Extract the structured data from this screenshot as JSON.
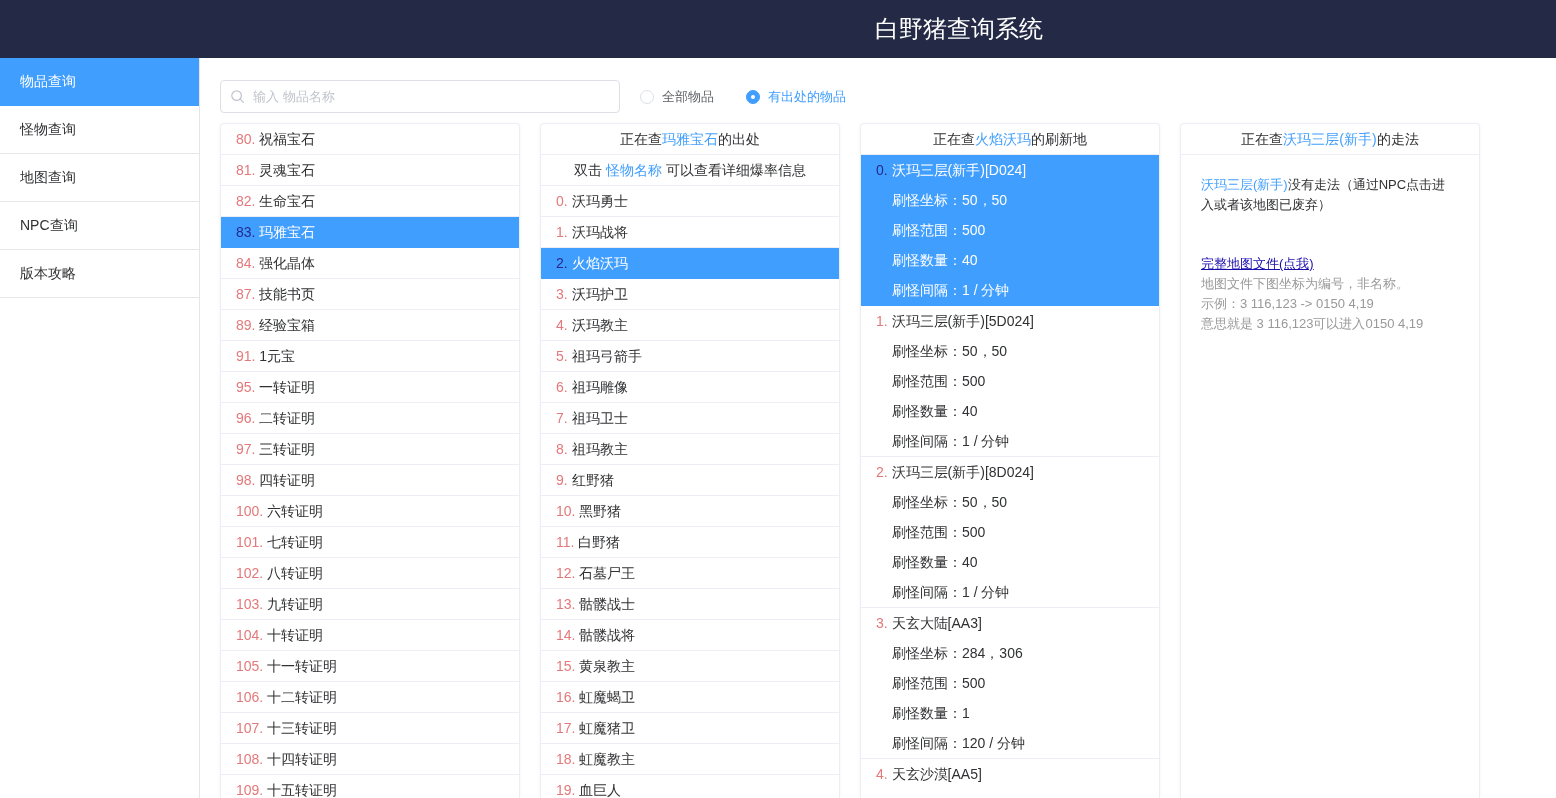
{
  "header": {
    "title": "白野猪查询系统"
  },
  "sidebar": {
    "items": [
      {
        "label": "物品查询",
        "selected": true
      },
      {
        "label": "怪物查询",
        "selected": false
      },
      {
        "label": "地图查询",
        "selected": false
      },
      {
        "label": "NPC查询",
        "selected": false
      },
      {
        "label": "版本攻略",
        "selected": false
      }
    ]
  },
  "search": {
    "placeholder": "输入 物品名称"
  },
  "filter": {
    "options": [
      {
        "label": "全部物品",
        "selected": false
      },
      {
        "label": "有出处的物品",
        "selected": true
      }
    ]
  },
  "items_panel": {
    "rows": [
      {
        "number": "80.",
        "name": "祝福宝石",
        "selected": false
      },
      {
        "number": "81.",
        "name": "灵魂宝石",
        "selected": false
      },
      {
        "number": "82.",
        "name": "生命宝石",
        "selected": false
      },
      {
        "number": "83.",
        "name": "玛雅宝石",
        "selected": true
      },
      {
        "number": "84.",
        "name": "强化晶体",
        "selected": false
      },
      {
        "number": "87.",
        "name": "技能书页",
        "selected": false
      },
      {
        "number": "89.",
        "name": "经验宝箱",
        "selected": false
      },
      {
        "number": "91.",
        "name": "1元宝",
        "selected": false
      },
      {
        "number": "95.",
        "name": "一转证明",
        "selected": false
      },
      {
        "number": "96.",
        "name": "二转证明",
        "selected": false
      },
      {
        "number": "97.",
        "name": "三转证明",
        "selected": false
      },
      {
        "number": "98.",
        "name": "四转证明",
        "selected": false
      },
      {
        "number": "100.",
        "name": "六转证明",
        "selected": false
      },
      {
        "number": "101.",
        "name": "七转证明",
        "selected": false
      },
      {
        "number": "102.",
        "name": "八转证明",
        "selected": false
      },
      {
        "number": "103.",
        "name": "九转证明",
        "selected": false
      },
      {
        "number": "104.",
        "name": "十转证明",
        "selected": false
      },
      {
        "number": "105.",
        "name": "十一转证明",
        "selected": false
      },
      {
        "number": "106.",
        "name": "十二转证明",
        "selected": false
      },
      {
        "number": "107.",
        "name": "十三转证明",
        "selected": false
      },
      {
        "number": "108.",
        "name": "十四转证明",
        "selected": false
      },
      {
        "number": "109.",
        "name": "十五转证明",
        "selected": false
      }
    ]
  },
  "sources_panel": {
    "heading": {
      "prefix": "正在查",
      "target": "玛雅宝石",
      "suffix": "的出处"
    },
    "hint": {
      "before": "双击",
      "highlight": "怪物名称",
      "after": "可以查看详细爆率信息"
    },
    "rows": [
      {
        "number": "0.",
        "name": "沃玛勇士",
        "selected": false
      },
      {
        "number": "1.",
        "name": "沃玛战将",
        "selected": false
      },
      {
        "number": "2.",
        "name": "火焰沃玛",
        "selected": true
      },
      {
        "number": "3.",
        "name": "沃玛护卫",
        "selected": false
      },
      {
        "number": "4.",
        "name": "沃玛教主",
        "selected": false
      },
      {
        "number": "5.",
        "name": "祖玛弓箭手",
        "selected": false
      },
      {
        "number": "6.",
        "name": "祖玛雕像",
        "selected": false
      },
      {
        "number": "7.",
        "name": "祖玛卫士",
        "selected": false
      },
      {
        "number": "8.",
        "name": "祖玛教主",
        "selected": false
      },
      {
        "number": "9.",
        "name": "红野猪",
        "selected": false
      },
      {
        "number": "10.",
        "name": "黑野猪",
        "selected": false
      },
      {
        "number": "11.",
        "name": "白野猪",
        "selected": false
      },
      {
        "number": "12.",
        "name": "石墓尸王",
        "selected": false
      },
      {
        "number": "13.",
        "name": "骷髅战士",
        "selected": false
      },
      {
        "number": "14.",
        "name": "骷髅战将",
        "selected": false
      },
      {
        "number": "15.",
        "name": "黄泉教主",
        "selected": false
      },
      {
        "number": "16.",
        "name": "虹魔蝎卫",
        "selected": false
      },
      {
        "number": "17.",
        "name": "虹魔猪卫",
        "selected": false
      },
      {
        "number": "18.",
        "name": "虹魔教主",
        "selected": false
      },
      {
        "number": "19.",
        "name": "血巨人",
        "selected": false
      }
    ]
  },
  "spawns_panel": {
    "heading": {
      "prefix": "正在查",
      "target": "火焰沃玛",
      "suffix": "的刷新地"
    },
    "entries": [
      {
        "number": "0.",
        "map": "沃玛三层(新手)[D024]",
        "selected": true,
        "details": [
          "刷怪坐标：50，50",
          "刷怪范围：500",
          "刷怪数量：40",
          "刷怪间隔：1 / 分钟"
        ]
      },
      {
        "number": "1.",
        "map": "沃玛三层(新手)[5D024]",
        "selected": false,
        "details": [
          "刷怪坐标：50，50",
          "刷怪范围：500",
          "刷怪数量：40",
          "刷怪间隔：1 / 分钟"
        ]
      },
      {
        "number": "2.",
        "map": "沃玛三层(新手)[8D024]",
        "selected": false,
        "details": [
          "刷怪坐标：50，50",
          "刷怪范围：500",
          "刷怪数量：40",
          "刷怪间隔：1 / 分钟"
        ]
      },
      {
        "number": "3.",
        "map": "天玄大陆[AA3]",
        "selected": false,
        "details": [
          "刷怪坐标：284，306",
          "刷怪范围：500",
          "刷怪数量：1",
          "刷怪间隔：120 / 分钟"
        ]
      },
      {
        "number": "4.",
        "map": "天玄沙漠[AA5]",
        "selected": false
      }
    ]
  },
  "route_panel": {
    "heading": {
      "prefix": "正在查",
      "target": "沃玛三层(新手)",
      "suffix": "的走法"
    },
    "note": {
      "highlight": "沃玛三层(新手)",
      "text": "没有走法（通过NPC点击进入或者该地图已废弃）"
    },
    "link": "完整地图文件(点我)",
    "hints": [
      "地图文件下图坐标为编号，非名称。",
      "示例：3 116,123 -> 0150 4,19",
      "意思就是 3 116,123可以进入0150 4,19"
    ]
  }
}
